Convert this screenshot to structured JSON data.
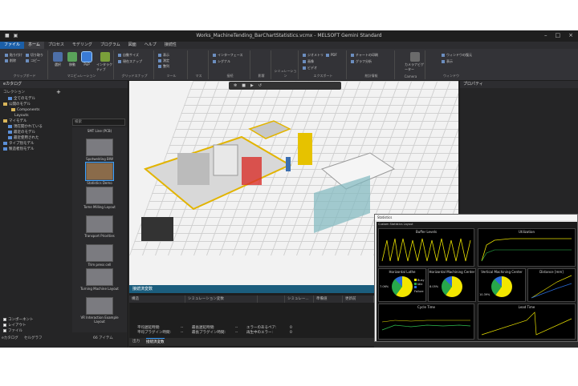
{
  "titlebar": {
    "title": "Works_MachineTending_BarChartStatistics.vcmx - MELSOFT Gemini Standard"
  },
  "menu": [
    "ファイル",
    "ホーム",
    "プロセス",
    "モデリング",
    "プログラム",
    "図面",
    "ヘルプ",
    "接続性"
  ],
  "ribbon": {
    "groups": [
      "クリップボード",
      "マニピュレーション",
      "グリッドスナップ",
      "ツール",
      "マス",
      "接続",
      "影響",
      "シミュレーション",
      "エクスポート",
      "統計情報",
      "Camera",
      "ウィンドウ"
    ],
    "buttons": {
      "select": "選択",
      "move": "移動",
      "pnp": "PnP",
      "interactive": "インタラクティブ",
      "camera": "カメラナビゲーター"
    },
    "smalls": [
      "貼り付け",
      "削除",
      "切り取り",
      "コピー",
      "自動サイズ",
      "現在スナップ",
      "表示",
      "測定",
      "整列",
      "インターフェース",
      "シグナル",
      "接続",
      "ジオメトリ",
      "PDF",
      "画像",
      "ビデオ",
      "チャートの印刷",
      "グラフ分析",
      "ウィンドウの復元",
      "表示"
    ]
  },
  "left": {
    "header": "eカタログ",
    "collection_label": "コレクション",
    "tree": [
      "全てのモデル",
      "公開のモデル",
      "Components",
      "Layouts",
      "マイモデル",
      "現在開かれている",
      "最近のモデル",
      "最近使用された",
      "タイプ別モデル",
      "製造者別モデル"
    ],
    "search_placeholder": "検索",
    "thumbs": [
      "SMT Line (PCB)",
      "Spotwelding BIW",
      "Statistics Demo",
      "Tome Milling Layout",
      "Transport Priorities",
      "Trim press cell",
      "Turning Machine Layout",
      "VR Interaction Example Layout"
    ],
    "checks": [
      "コンポーネント",
      "レイアウト",
      "ファイル"
    ],
    "count": "66 アイテム",
    "tabs": [
      "eカタログ",
      "セルグラフ"
    ]
  },
  "right": {
    "header": "プロパティ"
  },
  "bottom": {
    "header": "接続済変数",
    "columns": [
      "構造",
      "シミュレーション変数",
      "",
      "シミュレー...",
      "準備値",
      "更新前"
    ],
    "stats": [
      [
        "平均遅延時間:",
        "--",
        "最長遅延時間:",
        "--",
        "エラーのあるペア:",
        "0"
      ],
      [
        "平均プラグイン時間:",
        "--",
        "最長プラグイン時間:",
        "--",
        "再生中のエラー:",
        "0"
      ]
    ],
    "tabs": [
      "出力",
      "接続済変数"
    ]
  },
  "stat_window": {
    "title": "Statistics",
    "tab": "Custom Statistics Layout",
    "panes": [
      "Buffer Levels",
      "Utilization",
      "Horizontal Lathe",
      "Horizontal Machining Center",
      "Vertical Machining Center",
      "Distance [mm]",
      "Cycle Time",
      "Lead Time"
    ],
    "pie_pcts": [
      "7.06%",
      "8.05%",
      "10.39%"
    ],
    "legend": [
      "Busy",
      "Idle",
      "Failure"
    ]
  },
  "colors": {
    "accent": "#1b5fa8",
    "pie_busy": "#f2e600",
    "pie_idle": "#27a84a",
    "pie_fail": "#2b6cd9"
  }
}
